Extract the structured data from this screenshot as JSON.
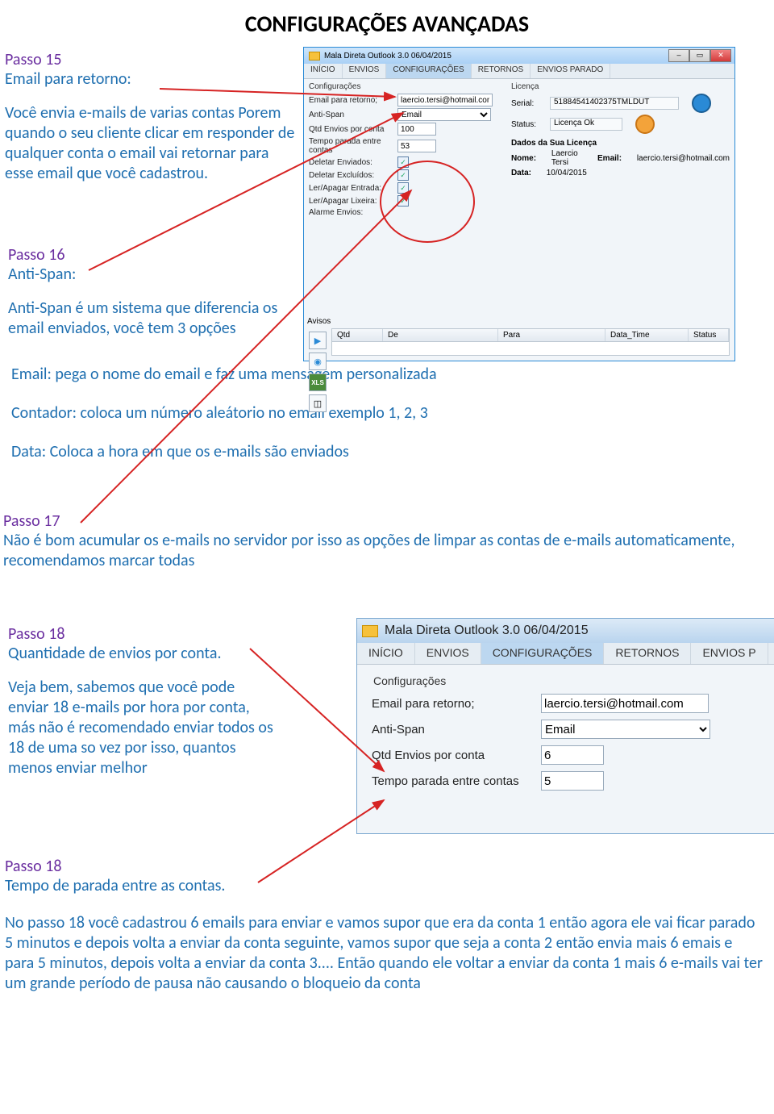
{
  "title": "CONFIGURAÇÕES AVANÇADAS",
  "passo15": {
    "heading": "Passo 15",
    "subheading": "Email para retorno:",
    "body": "Você envia e-mails de varias contas Porem quando o seu cliente clicar em responder de qualquer conta o email vai retornar para esse email que você cadastrou."
  },
  "passo16": {
    "heading": "Passo 16",
    "subheading": "Anti-Span:",
    "body": "Anti-Span é um sistema que diferencia os email enviados, você tem 3 opções",
    "opt1": "Email: pega o nome do email e faz uma mensagem personalizada",
    "opt2": "Contador: coloca um número aleátorio no email exemplo 1, 2, 3",
    "opt3": "Data: Coloca a hora em que os e-mails são enviados"
  },
  "passo17": {
    "heading": "Passo 17",
    "body": "Não é bom acumular os e-mails no servidor por isso as opções de limpar as contas de e-mails automaticamente, recomendamos marcar todas"
  },
  "passo18a": {
    "heading": "Passo 18",
    "subheading": "Quantidade de envios por conta.",
    "body": "Veja bem, sabemos que você pode enviar 18 e-mails por hora por conta, más não é recomendado enviar todos os 18 de uma so vez por isso, quantos menos enviar melhor"
  },
  "passo18b": {
    "heading": "Passo 18",
    "subheading": "Tempo de parada entre as contas.",
    "body": "No passo 18 você cadastrou 6 emails para enviar e vamos supor que era da conta 1 então agora ele vai ficar parado 5 minutos e depois volta a enviar da conta seguinte, vamos supor que seja a conta 2 então envia mais 6 emais e para 5 minutos, depois volta a enviar da conta 3.... Então quando ele voltar a enviar da conta 1 mais 6 e-mails vai ter um grande período de pausa não causando o bloqueio da conta"
  },
  "app1": {
    "title": "Mala Direta Outlook 3.0 06/04/2015",
    "tabs": [
      "INÍCIO",
      "ENVIOS",
      "CONFIGURAÇÕES",
      "RETORNOS",
      "ENVIOS PARADO"
    ],
    "activeTab": "CONFIGURAÇÕES",
    "section": "Configurações",
    "fields": {
      "email_label": "Email para retorno;",
      "email_value": "laercio.tersi@hotmail.com",
      "antispan_label": "Anti-Span",
      "antispan_value": "Email",
      "qtd_label": "Qtd Envios por conta",
      "qtd_value": "100",
      "tempo_label": "Tempo parada entre contas",
      "tempo_value": "53",
      "del_env_label": "Deletar Enviados:",
      "del_exc_label": "Deletar Excluídos:",
      "ler_ent_label": "Ler/Apagar Entrada:",
      "ler_lix_label": "Ler/Apagar Lixeira:",
      "alarme_label": "Alarme Envios:"
    },
    "licenca": {
      "title": "Licença",
      "serial_label": "Serial:",
      "serial_value": "51884541402375TMLDUT",
      "status_label": "Status:",
      "status_value": "Licença Ok",
      "dados_title": "Dados da Sua Licença",
      "nome_label": "Nome:",
      "nome_value": "Laercio Tersi",
      "email_label": "Email:",
      "email_value": "laercio.tersi@hotmail.com",
      "data_label": "Data:",
      "data_value": "10/04/2015"
    },
    "avisos_label": "Avisos",
    "grid": [
      "Qtd",
      "De",
      "Para",
      "Data_Time",
      "Status"
    ],
    "sidebtn_xls": "XLS"
  },
  "app2": {
    "title": "Mala Direta Outlook 3.0 06/04/2015",
    "tabs": [
      "INÍCIO",
      "ENVIOS",
      "CONFIGURAÇÕES",
      "RETORNOS",
      "ENVIOS P"
    ],
    "activeTab": "CONFIGURAÇÕES",
    "section": "Configurações",
    "fields": {
      "email_label": "Email para retorno;",
      "email_value": "laercio.tersi@hotmail.com",
      "antispan_label": "Anti-Span",
      "antispan_value": "Email",
      "qtd_label": "Qtd Envios por conta",
      "qtd_value": "6",
      "tempo_label": "Tempo parada entre contas",
      "tempo_value": "5"
    }
  }
}
